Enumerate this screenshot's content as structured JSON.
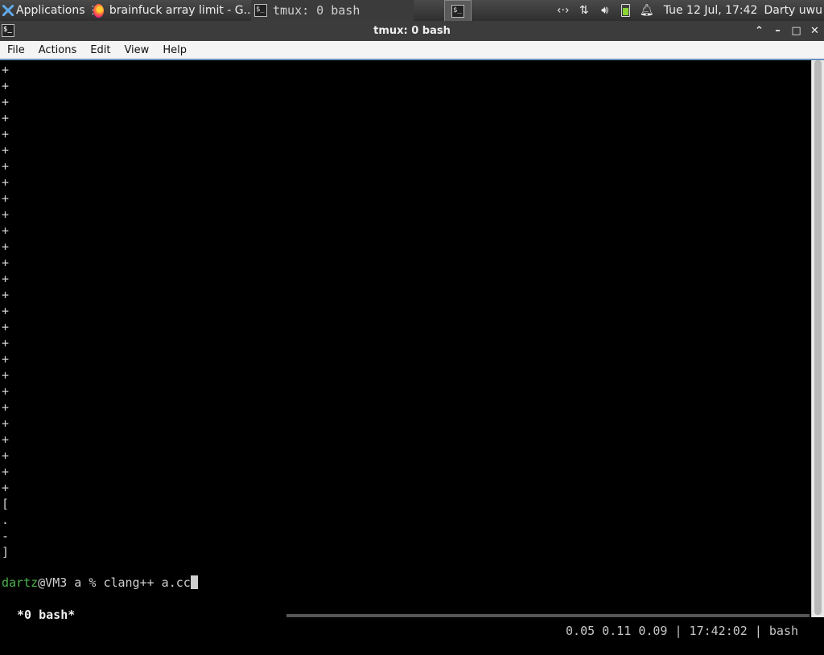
{
  "panel": {
    "applications_label": "Applications",
    "tasks": [
      {
        "label": "brainfuck array limit - G...",
        "icon": "firefox-icon"
      },
      {
        "label": "tmux: 0 bash",
        "icon": "terminal-icon"
      }
    ],
    "clock": "Tue 12 Jul, 17:42",
    "user": "Darty uwu"
  },
  "window": {
    "title": "tmux: 0 bash"
  },
  "menu": [
    "File",
    "Actions",
    "Edit",
    "View",
    "Help"
  ],
  "terminal": {
    "output_lines": [
      "+",
      "+",
      "+",
      "+",
      "+",
      "+",
      "+",
      "+",
      "+",
      "+",
      "+",
      "+",
      "+",
      "+",
      "+",
      "+",
      "+",
      "+",
      "+",
      "+",
      "+",
      "+",
      "+",
      "+",
      "+",
      "+",
      "+",
      "[",
      ".",
      "-",
      "]"
    ],
    "prompt_user": "dartz",
    "prompt_host_path": "@VM3 a % ",
    "command": "clang++ a.cc",
    "status_window": " *0 bash*",
    "status_right": "0.05 0.11 0.09 | 17:42:02 | bash"
  },
  "colors": {
    "terminal_bg": "#000000",
    "prompt_user": "#4db34d",
    "menu_accent": "#6c8fbd"
  }
}
